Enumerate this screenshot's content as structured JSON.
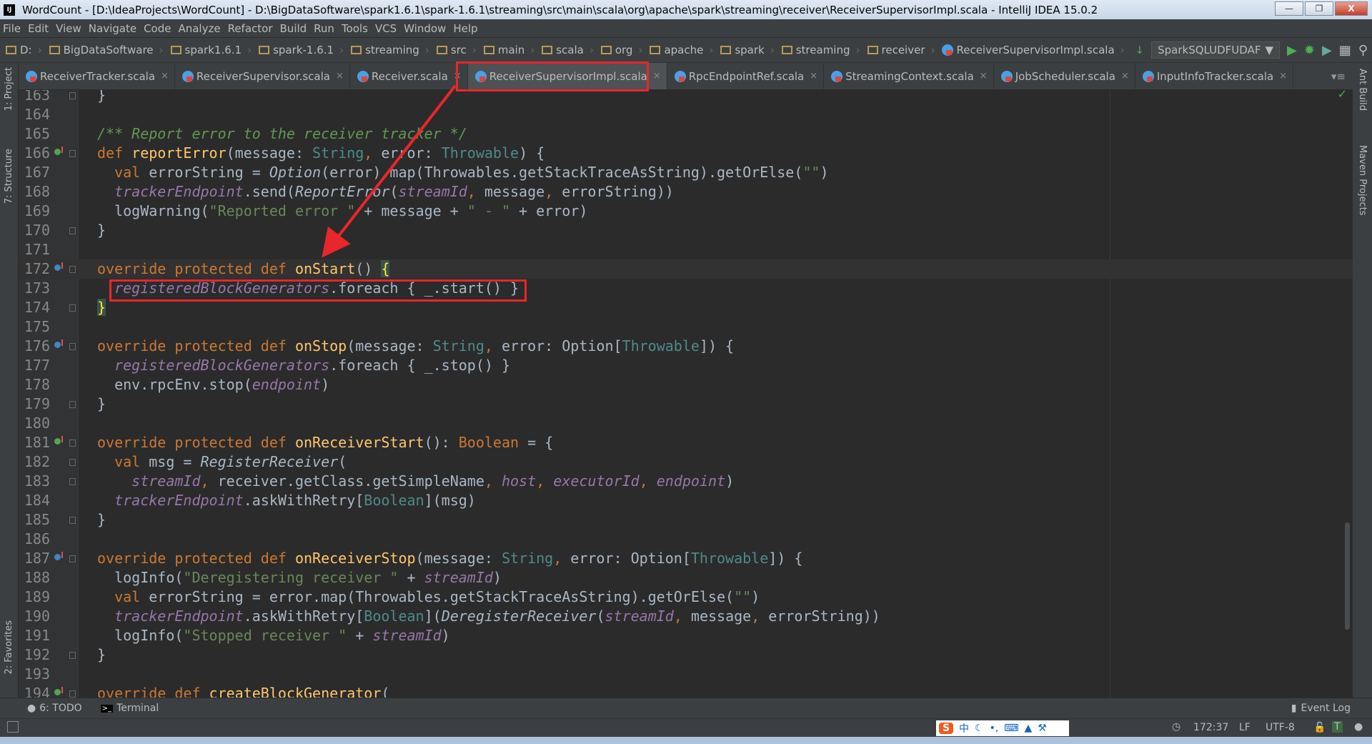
{
  "window": {
    "title": "WordCount - [D:\\IdeaProjects\\WordCount] - D:\\BigDataSoftware\\spark1.6.1\\spark-1.6.1\\streaming\\src\\main\\scala\\org\\apache\\spark\\streaming\\receiver\\ReceiverSupervisorImpl.scala - IntelliJ IDEA 15.0.2",
    "logo": "IJ"
  },
  "menu": [
    "File",
    "Edit",
    "View",
    "Navigate",
    "Code",
    "Analyze",
    "Refactor",
    "Build",
    "Run",
    "Tools",
    "VCS",
    "Window",
    "Help"
  ],
  "breadcrumbs": [
    "D:",
    "BigDataSoftware",
    "spark1.6.1",
    "spark-1.6.1",
    "streaming",
    "src",
    "main",
    "scala",
    "org",
    "apache",
    "spark",
    "streaming",
    "receiver",
    "ReceiverSupervisorImpl.scala"
  ],
  "run_config": "SparkSQLUDFUDAF",
  "tabs": [
    {
      "label": "ReceiverTracker.scala"
    },
    {
      "label": "ReceiverSupervisor.scala"
    },
    {
      "label": "Receiver.scala"
    },
    {
      "label": "ReceiverSupervisorImpl.scala",
      "active": true
    },
    {
      "label": "RpcEndpointRef.scala"
    },
    {
      "label": "StreamingContext.scala"
    },
    {
      "label": "JobScheduler.scala"
    },
    {
      "label": "InputInfoTracker.scala"
    }
  ],
  "tool_windows": {
    "left": [
      "1: Project",
      "7: Structure",
      "2: Favorites"
    ],
    "right": [
      "Ant Build",
      "Maven Projects"
    ],
    "bottom": [
      "6: TODO",
      "Terminal"
    ],
    "event_log": "Event Log"
  },
  "status": {
    "position": "172:37",
    "line_sep": "LF",
    "encoding": "UTF-8"
  },
  "ime": [
    "S",
    "中"
  ],
  "colors": {
    "annotation_red": "#e8262b",
    "keyword": "#cc7832",
    "function": "#ffc66d",
    "string": "#6a8759",
    "field": "#9876aa"
  },
  "code": [
    {
      "n": 163,
      "t": [
        [
          "p",
          "}"
        ]
      ],
      "fold": true
    },
    {
      "n": 164,
      "t": []
    },
    {
      "n": 165,
      "t": [
        [
          "c",
          "/** Report error to the receiver tracker */"
        ]
      ]
    },
    {
      "n": 166,
      "mark": "green",
      "fold": true,
      "t": [
        [
          "kw",
          "def "
        ],
        [
          "fn",
          "reportError"
        ],
        [
          "p",
          "(message: "
        ],
        [
          "ty",
          "String"
        ],
        [
          "kw",
          ", "
        ],
        [
          "p",
          "error: "
        ],
        [
          "ty",
          "Throwable"
        ],
        [
          "p",
          ") {"
        ]
      ]
    },
    {
      "n": 167,
      "t": [
        [
          "p",
          "  "
        ],
        [
          "kw",
          "val "
        ],
        [
          "p",
          "errorString = "
        ],
        [
          "i",
          "Option"
        ],
        [
          "p",
          "(error).map(Throwables.getStackTraceAsString).getOrElse("
        ],
        [
          "s",
          "\"\""
        ],
        [
          "p",
          ")"
        ]
      ]
    },
    {
      "n": 168,
      "t": [
        [
          "p",
          "  "
        ],
        [
          "v",
          "trackerEndpoint"
        ],
        [
          "p",
          ".send("
        ],
        [
          "i",
          "ReportError"
        ],
        [
          "p",
          "("
        ],
        [
          "v",
          "streamId"
        ],
        [
          "kw",
          ", "
        ],
        [
          "p",
          "message"
        ],
        [
          "kw",
          ", "
        ],
        [
          "p",
          "errorString))"
        ]
      ]
    },
    {
      "n": 169,
      "t": [
        [
          "p",
          "  logWarning("
        ],
        [
          "s",
          "\"Reported error \""
        ],
        [
          "p",
          " + message + "
        ],
        [
          "s",
          "\" - \""
        ],
        [
          "p",
          " + error)"
        ]
      ]
    },
    {
      "n": 170,
      "t": [
        [
          "p",
          "}"
        ]
      ],
      "fold": true
    },
    {
      "n": 171,
      "t": []
    },
    {
      "n": 172,
      "mark": "blue",
      "fold": true,
      "current": true,
      "t": [
        [
          "kw",
          "override protected def "
        ],
        [
          "fn",
          "onStart"
        ],
        [
          "p",
          "() "
        ],
        [
          "b",
          "{"
        ]
      ]
    },
    {
      "n": 173,
      "t": [
        [
          "p",
          "  "
        ],
        [
          "v",
          "registeredBlockGenerators"
        ],
        [
          "p",
          ".foreach { _.start() }"
        ]
      ]
    },
    {
      "n": 174,
      "fold": true,
      "t": [
        [
          "b",
          "}"
        ]
      ]
    },
    {
      "n": 175,
      "t": []
    },
    {
      "n": 176,
      "mark": "blue",
      "fold": true,
      "t": [
        [
          "kw",
          "override protected def "
        ],
        [
          "fn",
          "onStop"
        ],
        [
          "p",
          "(message: "
        ],
        [
          "ty",
          "String"
        ],
        [
          "kw",
          ", "
        ],
        [
          "p",
          "error: Option["
        ],
        [
          "ty",
          "Throwable"
        ],
        [
          "p",
          "]) {"
        ]
      ]
    },
    {
      "n": 177,
      "t": [
        [
          "p",
          "  "
        ],
        [
          "v",
          "registeredBlockGenerators"
        ],
        [
          "p",
          ".foreach { _.stop() }"
        ]
      ]
    },
    {
      "n": 178,
      "t": [
        [
          "p",
          "  env.rpcEnv.stop("
        ],
        [
          "v",
          "endpoint"
        ],
        [
          "p",
          ")"
        ]
      ]
    },
    {
      "n": 179,
      "fold": true,
      "t": [
        [
          "p",
          "}"
        ]
      ]
    },
    {
      "n": 180,
      "t": []
    },
    {
      "n": 181,
      "mark": "green",
      "fold": true,
      "t": [
        [
          "kw",
          "override protected def "
        ],
        [
          "fn",
          "onReceiverStart"
        ],
        [
          "p",
          "(): "
        ],
        [
          "kw",
          "Boolean"
        ],
        [
          "p",
          " = {"
        ]
      ]
    },
    {
      "n": 182,
      "fold": true,
      "t": [
        [
          "p",
          "  "
        ],
        [
          "kw",
          "val "
        ],
        [
          "p",
          "msg = "
        ],
        [
          "i",
          "RegisterReceiver"
        ],
        [
          "p",
          "("
        ]
      ]
    },
    {
      "n": 183,
      "fold": true,
      "t": [
        [
          "p",
          "    "
        ],
        [
          "v",
          "streamId"
        ],
        [
          "kw",
          ", "
        ],
        [
          "p",
          "receiver.getClass.getSimpleName"
        ],
        [
          "kw",
          ", "
        ],
        [
          "v",
          "host"
        ],
        [
          "kw",
          ", "
        ],
        [
          "v",
          "executorId"
        ],
        [
          "kw",
          ", "
        ],
        [
          "v",
          "endpoint"
        ],
        [
          "p",
          ")"
        ]
      ]
    },
    {
      "n": 184,
      "t": [
        [
          "p",
          "  "
        ],
        [
          "v",
          "trackerEndpoint"
        ],
        [
          "p",
          ".askWithRetry["
        ],
        [
          "ty",
          "Boolean"
        ],
        [
          "p",
          "](msg)"
        ]
      ]
    },
    {
      "n": 185,
      "fold": true,
      "t": [
        [
          "p",
          "}"
        ]
      ]
    },
    {
      "n": 186,
      "t": []
    },
    {
      "n": 187,
      "mark": "blue",
      "fold": true,
      "t": [
        [
          "kw",
          "override protected def "
        ],
        [
          "fn",
          "onReceiverStop"
        ],
        [
          "p",
          "(message: "
        ],
        [
          "ty",
          "String"
        ],
        [
          "kw",
          ", "
        ],
        [
          "p",
          "error: Option["
        ],
        [
          "ty",
          "Throwable"
        ],
        [
          "p",
          "]) {"
        ]
      ]
    },
    {
      "n": 188,
      "t": [
        [
          "p",
          "  logInfo("
        ],
        [
          "s",
          "\"Deregistering receiver \""
        ],
        [
          "p",
          " + "
        ],
        [
          "v",
          "streamId"
        ],
        [
          "p",
          ")"
        ]
      ]
    },
    {
      "n": 189,
      "t": [
        [
          "p",
          "  "
        ],
        [
          "kw",
          "val "
        ],
        [
          "p",
          "errorString = error.map(Throwables.getStackTraceAsString).getOrElse("
        ],
        [
          "s",
          "\"\""
        ],
        [
          "p",
          ")"
        ]
      ]
    },
    {
      "n": 190,
      "t": [
        [
          "p",
          "  "
        ],
        [
          "v",
          "trackerEndpoint"
        ],
        [
          "p",
          ".askWithRetry["
        ],
        [
          "ty",
          "Boolean"
        ],
        [
          "p",
          "]("
        ],
        [
          "i",
          "DeregisterReceiver"
        ],
        [
          "p",
          "("
        ],
        [
          "v",
          "streamId"
        ],
        [
          "kw",
          ", "
        ],
        [
          "p",
          "message"
        ],
        [
          "kw",
          ", "
        ],
        [
          "p",
          "errorString))"
        ]
      ]
    },
    {
      "n": 191,
      "t": [
        [
          "p",
          "  logInfo("
        ],
        [
          "s",
          "\"Stopped receiver \""
        ],
        [
          "p",
          " + "
        ],
        [
          "v",
          "streamId"
        ],
        [
          "p",
          ")"
        ]
      ]
    },
    {
      "n": 192,
      "fold": true,
      "t": [
        [
          "p",
          "}"
        ]
      ]
    },
    {
      "n": 193,
      "t": []
    },
    {
      "n": 194,
      "mark": "green",
      "fold": true,
      "t": [
        [
          "kw",
          "override def "
        ],
        [
          "fn",
          "createBlockGenerator"
        ],
        [
          "p",
          "("
        ]
      ]
    }
  ]
}
